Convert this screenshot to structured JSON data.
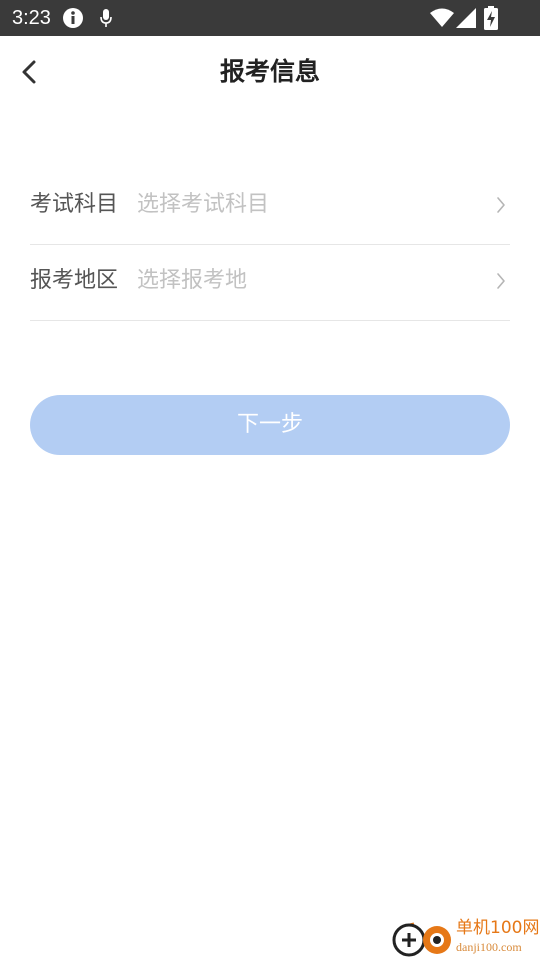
{
  "status_bar": {
    "time": "3:23"
  },
  "header": {
    "title": "报考信息"
  },
  "form": {
    "subject": {
      "label": "考试科目",
      "placeholder": "选择考试科目"
    },
    "region": {
      "label": "报考地区",
      "placeholder": "选择报考地"
    }
  },
  "next_button": {
    "label": "下一步"
  },
  "watermark": {
    "name": "单机100网",
    "url": "danji100.com"
  },
  "colors": {
    "status_bar_bg": "#3a3a3a",
    "button_bg": "#b3cdf3",
    "placeholder": "#c2c2c2",
    "label": "#555555",
    "watermark_orange": "#e67817"
  },
  "icons": {
    "back": "chevron-left-icon",
    "row_arrow": "chevron-right-icon",
    "info": "info-icon",
    "mic": "microphone-icon",
    "wifi": "wifi-icon",
    "signal": "cell-signal-icon",
    "battery": "battery-charging-icon"
  }
}
